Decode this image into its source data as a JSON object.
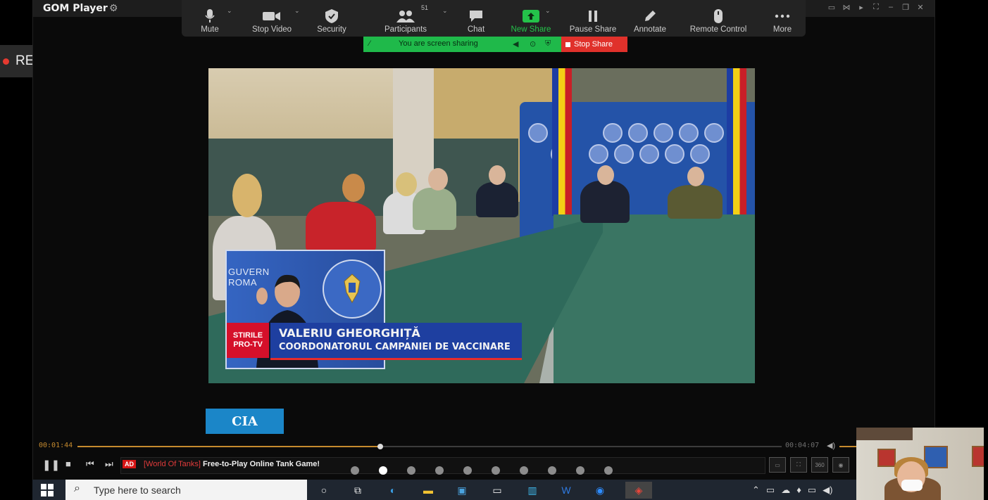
{
  "gom": {
    "title": "GOM Player",
    "time_current": "00:01:44",
    "time_total": "00:04:07",
    "progress": 0.43,
    "ad_tag": "AD",
    "ad_bracket": "[World Of Tanks]",
    "ad_text": "Free-to-Play Online Tank Game!",
    "logo_text": "CIA"
  },
  "zoom": {
    "participants_count": "51",
    "buttons": [
      {
        "label": "Mute",
        "icon": "microphone-icon"
      },
      {
        "label": "Stop Video",
        "icon": "video-camera-icon"
      },
      {
        "label": "Security",
        "icon": "shield-icon"
      },
      {
        "label": "Participants",
        "icon": "participants-icon"
      },
      {
        "label": "Chat",
        "icon": "chat-icon"
      },
      {
        "label": "New Share",
        "icon": "share-arrow-icon"
      },
      {
        "label": "Pause Share",
        "icon": "pause-icon"
      },
      {
        "label": "Annotate",
        "icon": "pencil-icon"
      },
      {
        "label": "Remote Control",
        "icon": "mouse-icon"
      },
      {
        "label": "More",
        "icon": "more-dots-icon"
      }
    ],
    "share_status": "You are screen sharing",
    "stop_share": "Stop Share",
    "accent_green": "#24c24a",
    "accent_red": "#e0312b"
  },
  "rec": {
    "label": "REC"
  },
  "broadcast": {
    "guv_text": "GUVERN\nROMA",
    "stiri_line1": "STIRILE",
    "stiri_line2": "PRO-TV",
    "name": "VALERIU GHEORGHIȚĂ",
    "role": "COORDONATORUL CAMPANIEI DE VACCINARE"
  },
  "taskbar": {
    "search_placeholder": "Type here to search"
  },
  "pager": {
    "count": 10,
    "active": 1
  }
}
